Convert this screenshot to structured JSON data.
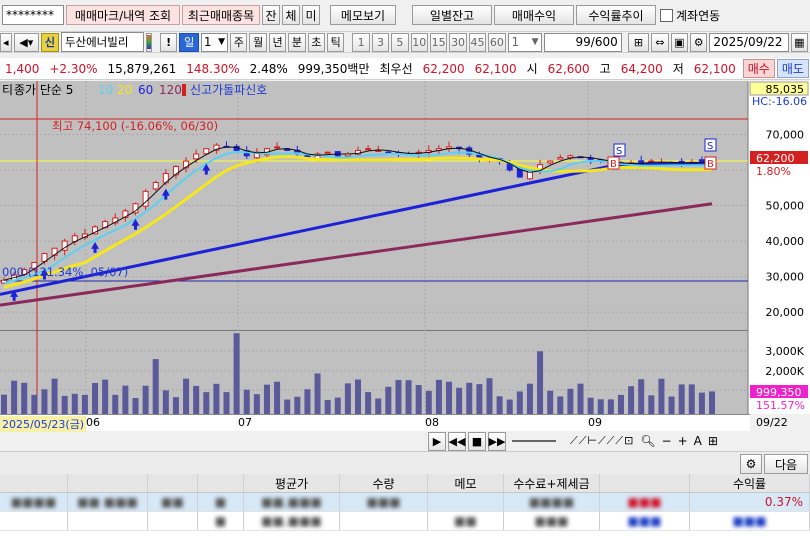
{
  "toolbar": {
    "account_mask": "********",
    "btn_trade_mark": "매매마크/내역 조회",
    "btn_recent": "최근매매종목",
    "btn_jan": "잔",
    "btn_che": "체",
    "btn_mi": "미",
    "btn_memo": "메모보기",
    "btn_daily_balance": "일별잔고",
    "btn_trade_profit": "매매수익",
    "btn_return_trend": "수익률추이",
    "link_label": "계좌연동"
  },
  "chart_toolbar": {
    "sin_badge": "신",
    "stock_name": "두산에너빌리",
    "exclaim": "!",
    "period_unit": "일",
    "period_count": "1",
    "periods": [
      "주",
      "월",
      "년",
      "분",
      "초",
      "틱"
    ],
    "numbers": [
      "1",
      "3",
      "5",
      "10",
      "15",
      "30",
      "45",
      "60"
    ],
    "count_value": "1",
    "view_count": "99",
    "view_total": "/600",
    "date": "2025/09/22"
  },
  "quote": {
    "price": "1,400",
    "change_pct": "+2.30%",
    "volume": "15,879,261",
    "vol_ratio": "148.30%",
    "turnover": "2.48%",
    "amount": "999,350백만",
    "best_label": "최우선",
    "best_ask": "62,200",
    "best_bid": "62,100",
    "open_label": "시",
    "open": "62,600",
    "high_label": "고",
    "high": "64,200",
    "low_label": "저",
    "low": "62,100",
    "buy_btn": "매수",
    "sell_btn": "매도"
  },
  "chart": {
    "legend_prefix": "티",
    "legend_ma": "종가 단순 5",
    "ma_values": [
      "10",
      "20",
      "60",
      "120"
    ],
    "ma_colors": [
      "#5ad1f0",
      "#f5e61e",
      "#1d22d6",
      "#8b2a5a"
    ],
    "signal_label": "신고가돌파신호",
    "annotation_high": "최고 74,100 (-16.06%, 06/30)",
    "annotation_low": "000 (131.34%, 05/07)",
    "top_value": "85,035",
    "hc_label": "HC:-16.06",
    "price_ticks": [
      "70,000",
      "60,000",
      "50,000",
      "40,000",
      "30,000",
      "20,000"
    ],
    "current_price": "62,200",
    "current_pct": "1.80%",
    "volume_ticks": [
      "3,000K",
      "2,000K",
      "1,000K"
    ],
    "current_volume": "999,350",
    "volume_pct": "151.57%",
    "time_labels": [
      "2025/05/23(금)",
      "06",
      "07",
      "08",
      "09",
      "09/22"
    ],
    "s_marker": "S",
    "b_marker": "B"
  },
  "table": {
    "settings_icon": "gear-icon",
    "next_btn": "다음",
    "headers": [
      "",
      "",
      "",
      "",
      "평균가",
      "수량",
      "메모",
      "수수료+제세금",
      "",
      "수익률"
    ],
    "rows": [
      {
        "cells": [
          "",
          "",
          "",
          "",
          "",
          "",
          "",
          "",
          "",
          "0.37%"
        ]
      },
      {
        "cells": [
          "",
          "",
          "",
          "",
          "",
          "",
          "",
          "",
          "",
          ""
        ]
      },
      {
        "cells": [
          "",
          "",
          "",
          "",
          "",
          "",
          "",
          "",
          "",
          ""
        ]
      }
    ]
  },
  "chart_data": {
    "type": "candlestick",
    "title": "",
    "xlabel": "",
    "ylabel": "",
    "x_labels": [
      "06",
      "07",
      "08",
      "09",
      "09/22"
    ],
    "ylim": [
      15000,
      85035
    ],
    "close_series": [
      29000,
      30500,
      32000,
      34000,
      36500,
      38000,
      40000,
      41500,
      42000,
      44000,
      45500,
      46500,
      48500,
      50500,
      54000,
      56500,
      59000,
      61000,
      62500,
      64500,
      66000,
      67000,
      66500,
      65500,
      64000,
      65000,
      66000,
      66500,
      65500,
      64500,
      63500,
      64500,
      65000,
      64000,
      64500,
      65500,
      66000,
      65500,
      65000,
      64500,
      64500,
      65000,
      65500,
      66000,
      66500,
      66000,
      64500,
      63500,
      63000,
      62500,
      60000,
      58000,
      60000,
      61500,
      62500,
      63500,
      64000,
      63500,
      63000,
      62500,
      62000,
      61500,
      62000,
      62000,
      62500,
      62200,
      61800,
      62000,
      62200,
      62500,
      62200
    ],
    "highlight_lines": [
      {
        "name": "high",
        "value": 74100
      },
      {
        "name": "current",
        "value": 62200
      },
      {
        "name": "low",
        "value": 23500
      }
    ]
  }
}
